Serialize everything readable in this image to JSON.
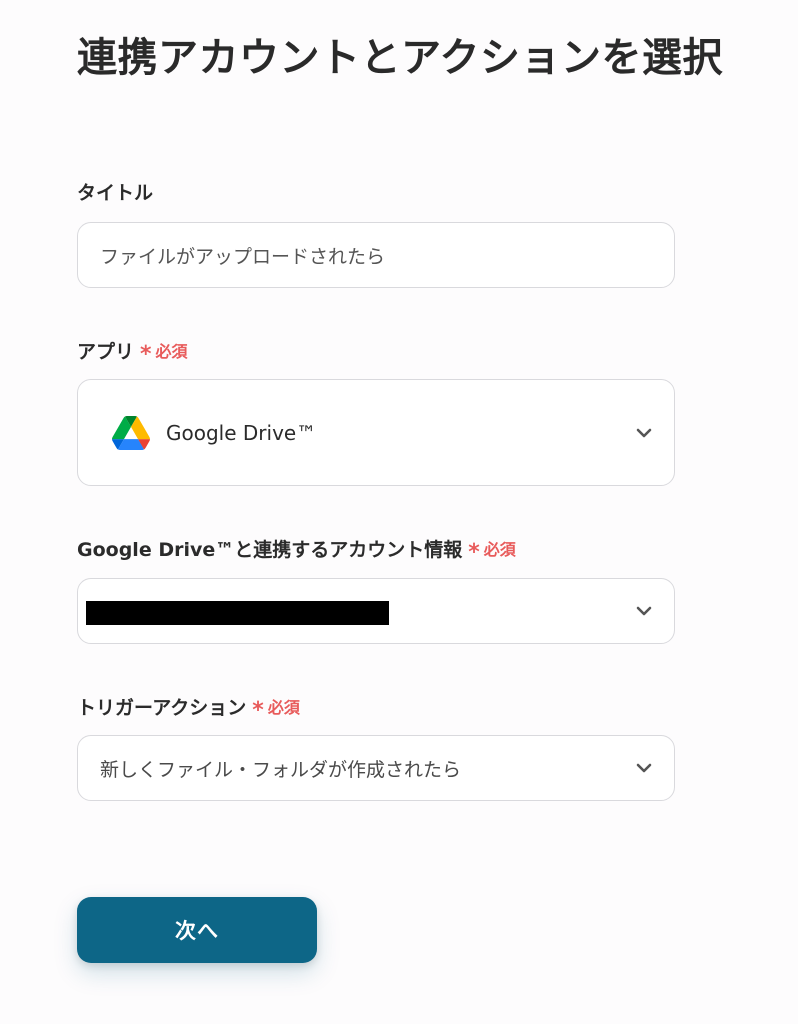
{
  "page": {
    "title": "連携アカウントとアクションを選択"
  },
  "required_marker": {
    "star": "*",
    "text": "必須"
  },
  "fields": {
    "title_field": {
      "label": "タイトル",
      "value": "ファイルがアップロードされたら"
    },
    "app_field": {
      "label": "アプリ",
      "selected": "Google Drive™",
      "icon": "google-drive-icon"
    },
    "account_field": {
      "label": "Google Drive™と連携するアカウント情報"
    },
    "trigger_field": {
      "label": "トリガーアクション",
      "selected": "新しくファイル・フォルダが作成されたら"
    }
  },
  "actions": {
    "next_label": "次へ"
  },
  "colors": {
    "primary": "#0d6687",
    "required": "#e85b5b",
    "border": "#d9d9dd",
    "drive_green": "#1fa463",
    "drive_yellow": "#ffd04b",
    "drive_blue": "#4688f4"
  }
}
